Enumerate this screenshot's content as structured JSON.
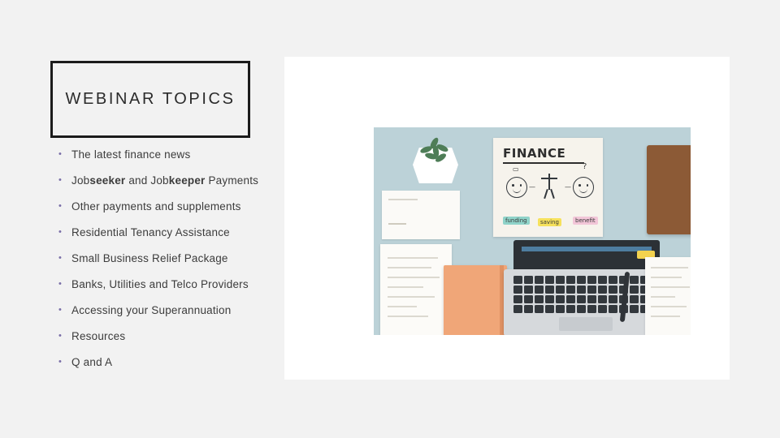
{
  "slide": {
    "title": "WEBINAR TOPICS",
    "bullet_marker": "•",
    "bullets": [
      {
        "parts": [
          {
            "text": "The latest finance news",
            "bold": false
          }
        ]
      },
      {
        "parts": [
          {
            "text": "Job",
            "bold": false
          },
          {
            "text": "seeker",
            "bold": true
          },
          {
            "text": " and Job",
            "bold": false
          },
          {
            "text": "keeper",
            "bold": true
          },
          {
            "text": " Payments",
            "bold": false
          }
        ]
      },
      {
        "parts": [
          {
            "text": "Other payments and supplements",
            "bold": false
          }
        ]
      },
      {
        "parts": [
          {
            "text": "Residential Tenancy Assistance",
            "bold": false
          }
        ]
      },
      {
        "parts": [
          {
            "text": "Small Business Relief Package",
            "bold": false
          }
        ]
      },
      {
        "parts": [
          {
            "text": "Banks, Utilities and Telco Providers",
            "bold": false
          }
        ]
      },
      {
        "parts": [
          {
            "text": "Accessing your Superannuation",
            "bold": false
          }
        ]
      },
      {
        "parts": [
          {
            "text": "Resources",
            "bold": false
          }
        ]
      },
      {
        "parts": [
          {
            "text": "Q and A",
            "bold": false
          }
        ]
      }
    ],
    "colors": {
      "background": "#f2f2f2",
      "title_border": "#1b1b1b",
      "title_text": "#2b2b2b",
      "bullet_text": "#3c3c3c",
      "bullet_marker": "#7a6fa8",
      "photo_frame": "#ffffff"
    }
  },
  "photo": {
    "description": "Flat-lay desk photo on light blue background with laptop, notebooks and a hand-drawn FINANCE poster",
    "poster": {
      "title": "FINANCE",
      "labels": [
        "funding",
        "saving",
        "benefit"
      ],
      "label_colors": [
        "#8fd3c9",
        "#f6e15c",
        "#f2c6d8"
      ]
    }
  }
}
